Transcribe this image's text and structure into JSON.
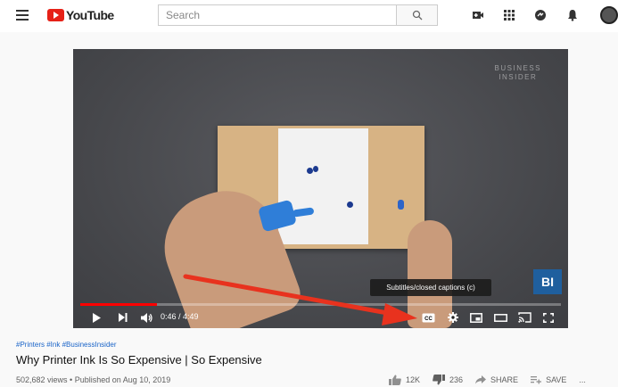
{
  "header": {
    "logo_text": "YouTube",
    "search_placeholder": "Search",
    "icons": [
      "menu-icon",
      "video-camera-icon",
      "apps-grid-icon",
      "messages-icon",
      "notifications-bell-icon",
      "account-avatar"
    ]
  },
  "player": {
    "watermark_line1": "BUSINESS",
    "watermark_line2": "INSIDER",
    "bi_badge": "BI",
    "tooltip": "Subtitles/closed captions (c)",
    "time_text": "0:46 / 4:49",
    "progress": 0.159,
    "controls": [
      "play-icon",
      "next-icon",
      "volume-icon",
      "captions-icon",
      "settings-icon",
      "miniplayer-icon",
      "theater-mode-icon",
      "cast-icon",
      "fullscreen-icon"
    ]
  },
  "video": {
    "hashtags": "#Printers #Ink #BusinessInsider",
    "title": "Why Printer Ink Is So Expensive | So Expensive",
    "meta": "502,682 views • Published on Aug 10, 2019",
    "likes": "12K",
    "dislikes": "236",
    "share_label": "SHARE",
    "save_label": "SAVE",
    "more_label": "..."
  },
  "colors": {
    "brand_red": "#e62117",
    "progress_red": "#ff0000",
    "arrow_red": "#e8321e",
    "link_blue": "#1a64c8"
  }
}
